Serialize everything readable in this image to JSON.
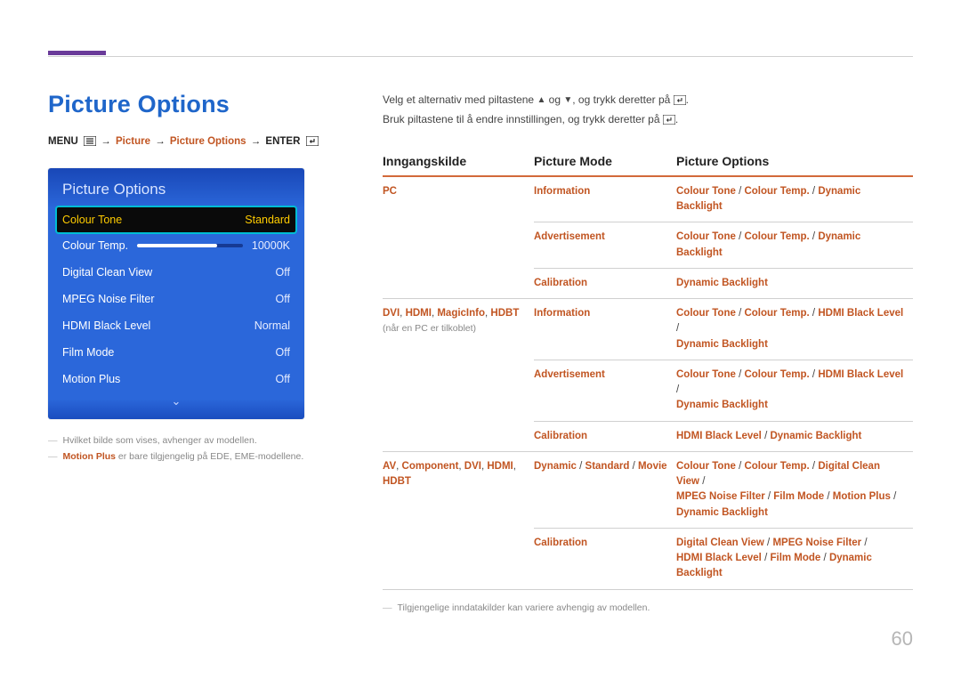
{
  "page_number": "60",
  "title": "Picture Options",
  "breadcrumb": {
    "menu": "MENU",
    "picture": "Picture",
    "picture_options": "Picture Options",
    "enter": "ENTER"
  },
  "osd": {
    "title": "Picture Options",
    "rows": [
      {
        "label": "Colour Tone",
        "value": "Standard",
        "selected": true
      },
      {
        "label": "Colour Temp.",
        "value": "10000K",
        "slider": true
      },
      {
        "label": "Digital Clean View",
        "value": "Off"
      },
      {
        "label": "MPEG Noise Filter",
        "value": "Off"
      },
      {
        "label": "HDMI Black Level",
        "value": "Normal"
      },
      {
        "label": "Film Mode",
        "value": "Off"
      },
      {
        "label": "Motion Plus",
        "value": "Off"
      }
    ],
    "notes": {
      "note1": "Hvilket bilde som vises, avhenger av modellen.",
      "note2_prefix": "Motion Plus",
      "note2_rest": " er bare tilgjengelig på EDE, EME-modellene."
    }
  },
  "intro": {
    "line1_a": "Velg et alternativ med piltastene ",
    "line1_b": " og ",
    "line1_c": ", og trykk deretter på ",
    "line2_a": "Bruk piltastene til å endre innstillingen, og trykk deretter på "
  },
  "table": {
    "headers": {
      "c1": "Inngangskilde",
      "c2": "Picture Mode",
      "c3": "Picture Options"
    },
    "rows": [
      {
        "c1": [
          {
            "t": "PC",
            "o": true
          }
        ],
        "c2": [
          {
            "t": "Information",
            "o": true
          }
        ],
        "c3": [
          {
            "t": "Colour Tone",
            "o": true
          },
          {
            "t": " / "
          },
          {
            "t": "Colour Temp.",
            "o": true
          },
          {
            "t": " / "
          },
          {
            "t": "Dynamic Backlight",
            "o": true
          }
        ],
        "nb1": true
      },
      {
        "c1": [],
        "c2": [
          {
            "t": "Advertisement",
            "o": true
          }
        ],
        "c3": [
          {
            "t": "Colour Tone",
            "o": true
          },
          {
            "t": " / "
          },
          {
            "t": "Colour Temp.",
            "o": true
          },
          {
            "t": " / "
          },
          {
            "t": "Dynamic Backlight",
            "o": true
          }
        ],
        "nb1": true
      },
      {
        "c1": [],
        "c2": [
          {
            "t": "Calibration",
            "o": true
          }
        ],
        "c3": [
          {
            "t": "Dynamic Backlight",
            "o": true
          }
        ]
      },
      {
        "c1": [
          {
            "t": "DVI",
            "o": true
          },
          {
            "t": ", "
          },
          {
            "t": "HDMI",
            "o": true
          },
          {
            "t": ", "
          },
          {
            "t": "MagicInfo",
            "o": true
          },
          {
            "t": ", "
          },
          {
            "t": "HDBT",
            "o": true
          }
        ],
        "c1sub": "(når en PC er tilkoblet)",
        "c2": [
          {
            "t": "Information",
            "o": true
          }
        ],
        "c3": [
          {
            "t": "Colour Tone",
            "o": true
          },
          {
            "t": " / "
          },
          {
            "t": "Colour Temp.",
            "o": true
          },
          {
            "t": " / "
          },
          {
            "t": "HDMI Black Level",
            "o": true
          },
          {
            "t": " / "
          },
          {
            "br": true
          },
          {
            "t": "Dynamic Backlight",
            "o": true
          }
        ],
        "nb1": true
      },
      {
        "c1": [],
        "c2": [
          {
            "t": "Advertisement",
            "o": true
          }
        ],
        "c3": [
          {
            "t": "Colour Tone",
            "o": true
          },
          {
            "t": " / "
          },
          {
            "t": "Colour Temp.",
            "o": true
          },
          {
            "t": " / "
          },
          {
            "t": "HDMI Black Level",
            "o": true
          },
          {
            "t": " / "
          },
          {
            "br": true
          },
          {
            "t": "Dynamic Backlight",
            "o": true
          }
        ],
        "nb1": true
      },
      {
        "c1": [],
        "c2": [
          {
            "t": "Calibration",
            "o": true
          }
        ],
        "c3": [
          {
            "t": "HDMI Black Level",
            "o": true
          },
          {
            "t": " / "
          },
          {
            "t": "Dynamic Backlight",
            "o": true
          }
        ]
      },
      {
        "c1": [
          {
            "t": "AV",
            "o": true
          },
          {
            "t": ", "
          },
          {
            "t": "Component",
            "o": true
          },
          {
            "t": ", "
          },
          {
            "t": "DVI",
            "o": true
          },
          {
            "t": ", "
          },
          {
            "t": "HDMI",
            "o": true
          },
          {
            "t": ", "
          },
          {
            "br": true
          },
          {
            "t": "HDBT",
            "o": true
          }
        ],
        "c2": [
          {
            "t": "Dynamic",
            "o": true
          },
          {
            "t": " / "
          },
          {
            "t": "Standard",
            "o": true
          },
          {
            "t": " / "
          },
          {
            "t": "Movie",
            "o": true
          }
        ],
        "c3": [
          {
            "t": "Colour Tone",
            "o": true
          },
          {
            "t": " / "
          },
          {
            "t": "Colour Temp.",
            "o": true
          },
          {
            "t": " / "
          },
          {
            "t": "Digital Clean View",
            "o": true
          },
          {
            "t": " / "
          },
          {
            "br": true
          },
          {
            "t": "MPEG Noise Filter",
            "o": true
          },
          {
            "t": " / "
          },
          {
            "t": "Film Mode",
            "o": true
          },
          {
            "t": " / "
          },
          {
            "t": "Motion Plus",
            "o": true
          },
          {
            "t": " / "
          },
          {
            "br": true
          },
          {
            "t": "Dynamic Backlight",
            "o": true
          }
        ],
        "nb1": true
      },
      {
        "c1": [],
        "c2": [
          {
            "t": "Calibration",
            "o": true
          }
        ],
        "c3": [
          {
            "t": "Digital Clean View",
            "o": true
          },
          {
            "t": " / "
          },
          {
            "t": "MPEG Noise Filter",
            "o": true
          },
          {
            "t": " / "
          },
          {
            "br": true
          },
          {
            "t": "HDMI Black Level",
            "o": true
          },
          {
            "t": " / "
          },
          {
            "t": "Film Mode",
            "o": true
          },
          {
            "t": " / "
          },
          {
            "t": "Dynamic Backlight",
            "o": true
          }
        ]
      }
    ],
    "footnote": "Tilgjengelige inndatakilder kan variere avhengig av modellen."
  }
}
